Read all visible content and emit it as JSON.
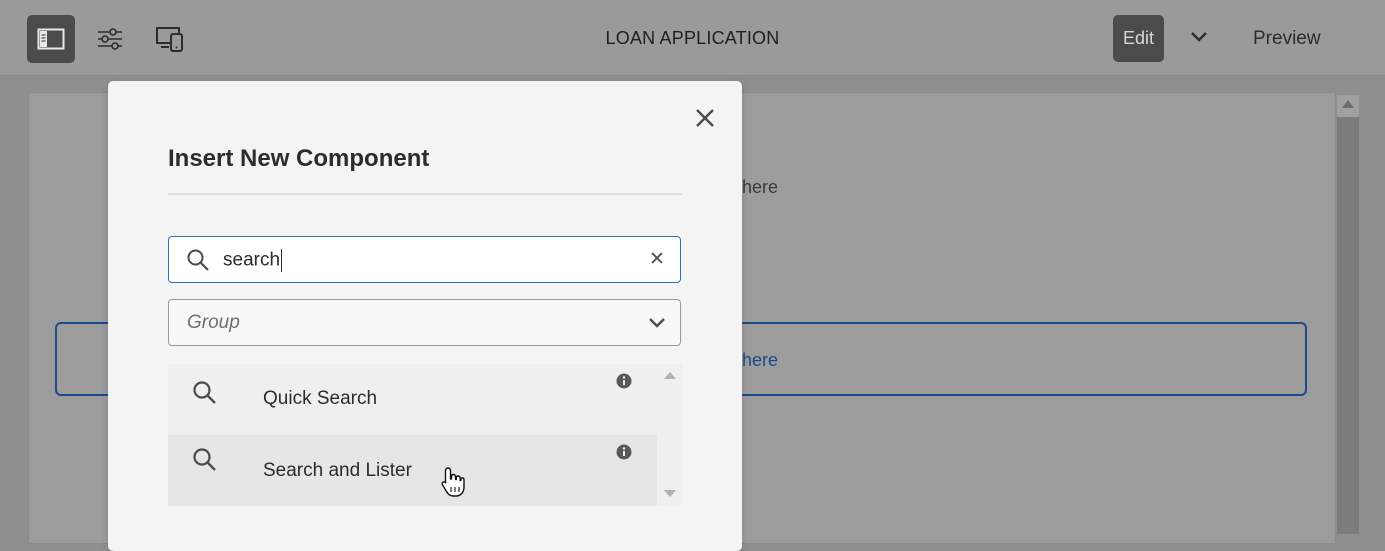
{
  "toolbar": {
    "icons": [
      "side-panel-icon",
      "properties-icon",
      "emulator-icon"
    ],
    "title": "LOAN APPLICATION",
    "edit_label": "Edit",
    "preview_label": "Preview"
  },
  "page": {
    "drag_text_1": "here",
    "drag_text_2": "here"
  },
  "dialog": {
    "title": "Insert New Component",
    "search": {
      "value": "search",
      "placeholder": ""
    },
    "group": {
      "placeholder": "Group"
    },
    "results": [
      {
        "label": "Quick Search",
        "icon": "search-icon"
      },
      {
        "label": "Search and Lister",
        "icon": "search-icon"
      }
    ]
  },
  "colors": {
    "accent": "#2c6fb3",
    "drop_zone": "#1d4a8c"
  }
}
